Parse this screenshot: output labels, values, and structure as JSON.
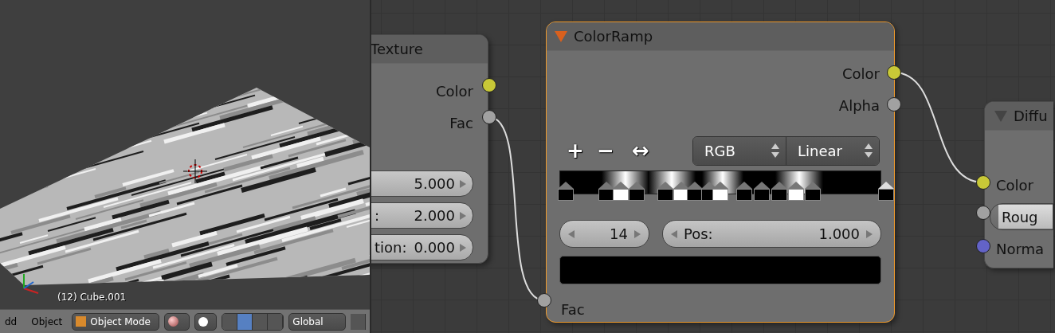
{
  "viewport": {
    "object_label": "(12) Cube.001"
  },
  "header": {
    "menus": [
      "dd",
      "Object"
    ],
    "mode": "Object Mode",
    "orientation": "Global"
  },
  "texture_node": {
    "title": "Texture",
    "outputs": [
      {
        "label": "Color",
        "color": "#c8c837"
      },
      {
        "label": "Fac",
        "color": "#a1a1a1"
      }
    ],
    "fields": [
      {
        "value": "5.000"
      },
      {
        "label": ":",
        "value": "2.000"
      },
      {
        "label": "tion:",
        "value": "0.000"
      }
    ]
  },
  "colorramp_node": {
    "title": "ColorRamp",
    "expanded": true,
    "selected": true,
    "outputs": [
      {
        "label": "Color",
        "color": "#c8c837"
      },
      {
        "label": "Alpha",
        "color": "#a1a1a1"
      }
    ],
    "tools": [
      "+",
      "−",
      "↔"
    ],
    "color_mode": "RGB",
    "interpolation": "Linear",
    "stops": [
      {
        "color": "#000000",
        "selected": false
      },
      {
        "color": "#000000",
        "selected": false
      },
      {
        "color": "#ffffff",
        "selected": false
      },
      {
        "color": "#000000",
        "selected": false
      },
      {
        "color": "#000000",
        "selected": false
      },
      {
        "color": "#ffffff",
        "selected": false
      },
      {
        "color": "#000000",
        "selected": false
      },
      {
        "color": "#000000",
        "selected": false
      },
      {
        "color": "#ffffff",
        "selected": false
      },
      {
        "color": "#000000",
        "selected": false
      },
      {
        "color": "#000000",
        "selected": false
      },
      {
        "color": "#000000",
        "selected": false
      },
      {
        "color": "#ffffff",
        "selected": false
      },
      {
        "color": "#000000",
        "selected": false
      },
      {
        "color": "#000000",
        "selected": true
      }
    ],
    "active_index": "14",
    "pos_label": "Pos:",
    "pos_value": "1.000",
    "input": {
      "label": "Fac",
      "color": "#a1a1a1"
    }
  },
  "diffuse_node": {
    "title": "Diffu",
    "inputs": [
      {
        "kind": "socket",
        "label": "Color",
        "color": "#c8c837"
      },
      {
        "kind": "field",
        "label": "Roug",
        "color": "#a1a1a1"
      },
      {
        "kind": "socket",
        "label": "Norma",
        "color": "#6363c7"
      }
    ]
  }
}
